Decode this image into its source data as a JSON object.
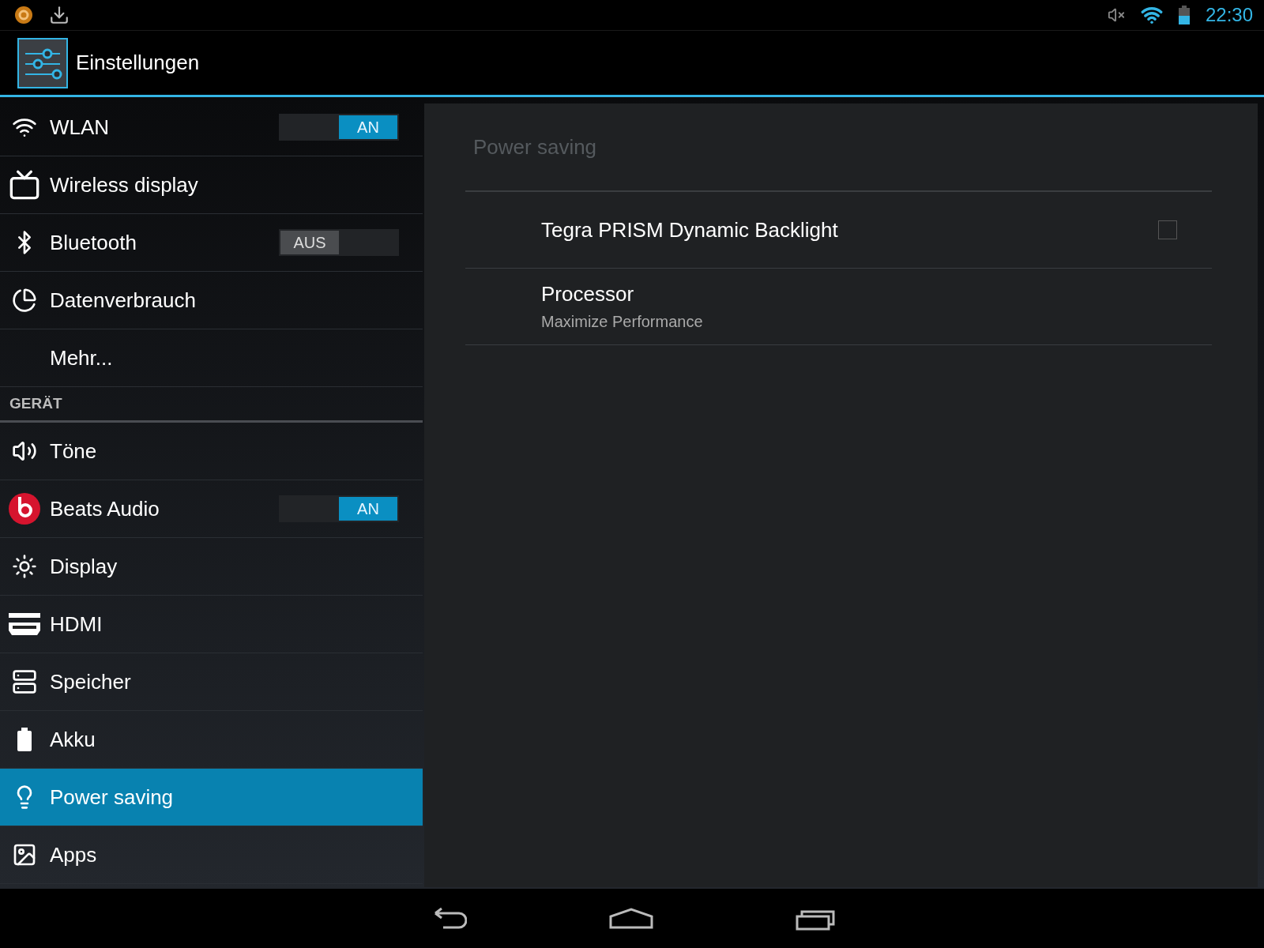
{
  "status_bar": {
    "time": "22:30"
  },
  "action_bar": {
    "title": "Einstellungen"
  },
  "sidebar": {
    "items": [
      {
        "kind": "toggle",
        "label": "WLAN",
        "selected": false,
        "on": true,
        "toggle_label": "AN"
      },
      {
        "kind": "item",
        "label": "Wireless display",
        "selected": false
      },
      {
        "kind": "toggle",
        "label": "Bluetooth",
        "selected": false,
        "on": false,
        "toggle_label": "AUS"
      },
      {
        "kind": "item",
        "label": "Datenverbrauch",
        "selected": false
      },
      {
        "kind": "item",
        "label": "Mehr...",
        "selected": false
      },
      {
        "kind": "header",
        "label": "GERÄT"
      },
      {
        "kind": "item",
        "label": "Töne",
        "selected": false
      },
      {
        "kind": "toggle",
        "label": "Beats Audio",
        "selected": false,
        "on": true,
        "toggle_label": "AN"
      },
      {
        "kind": "item",
        "label": "Display",
        "selected": false
      },
      {
        "kind": "item",
        "label": "HDMI",
        "selected": false
      },
      {
        "kind": "item",
        "label": "Speicher",
        "selected": false
      },
      {
        "kind": "item",
        "label": "Akku",
        "selected": false
      },
      {
        "kind": "item",
        "label": "Power saving",
        "selected": true
      },
      {
        "kind": "item",
        "label": "Apps",
        "selected": false
      }
    ]
  },
  "detail": {
    "title": "Power saving",
    "settings": [
      {
        "kind": "checkbox",
        "title": "Tegra PRISM Dynamic Backlight",
        "checked": false
      },
      {
        "kind": "summary",
        "title": "Processor",
        "summary": "Maximize Performance"
      }
    ]
  }
}
